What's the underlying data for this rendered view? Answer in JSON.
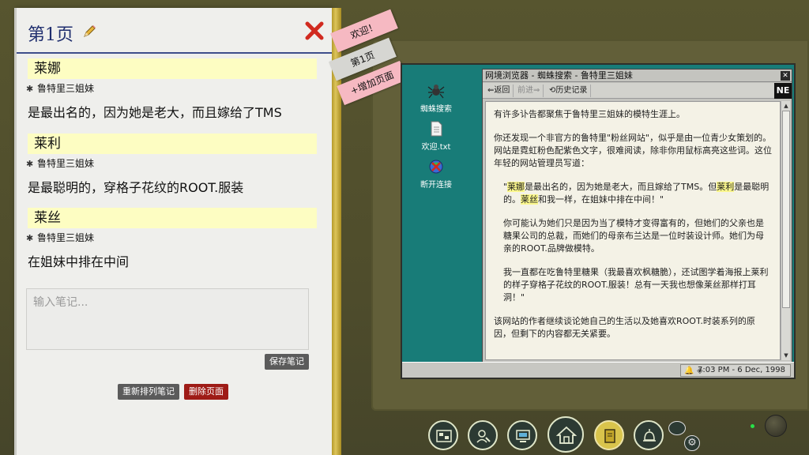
{
  "notebook": {
    "page_title": "第1页",
    "entries": [
      {
        "name": "莱娜",
        "tag": "鲁特里三姐妹",
        "note": "是最出名的，因为她是老大，而且嫁给了TMS"
      },
      {
        "name": "莱利",
        "tag": "鲁特里三姐妹",
        "note": "是最聪明的，穿格子花纹的ROOT.服装"
      },
      {
        "name": "莱丝",
        "tag": "鲁特里三姐妹",
        "note": "在姐妹中排在中间"
      }
    ],
    "note_placeholder": "输入笔记...",
    "save_label": "保存笔记",
    "reorder_label": "重新排列笔记",
    "delete_label": "删除页面"
  },
  "tabs": {
    "welcome": "欢迎！",
    "page1": "第1页",
    "add": "+增加页面"
  },
  "desktop": {
    "icons": [
      {
        "label": "蜘蛛搜索",
        "icon": "spider-icon"
      },
      {
        "label": "欢迎.txt",
        "icon": "text-file-icon"
      },
      {
        "label": "断开连接",
        "icon": "disconnect-icon"
      }
    ],
    "clock": "7:03 PM - 6 Dec, 1998"
  },
  "browser": {
    "title": "网境浏览器 - 蜘蛛搜索 - 鲁特里三姐妹",
    "back": "返回",
    "forward": "前进",
    "history": "历史记录",
    "logo": "NE",
    "p1": "有许多讣告都聚焦于鲁特里三姐妹的模特生涯上。",
    "p2": "你还发现一个非官方的鲁特里\"粉丝网站\"，似乎是由一位青少女策划的。网站是霓虹粉色配紫色文字，很难阅读，除非你用鼠标高亮这些词。这位年轻的网站管理员写道：",
    "q1_a": "\"",
    "q1_hl1": "莱娜",
    "q1_b": "是最出名的，因为她是老大，而且嫁给了TMS。但",
    "q1_hl2": "莱利",
    "q1_c": "是最聪明的。",
    "q1_hl3": "莱丝",
    "q1_d": "和我一样，在姐妹中排在中间！\"",
    "q2": "你可能认为她们只是因为当了模特才变得富有的，但她们的父亲也是糖果公司的总裁，而她们的母亲布兰达是一位时装设计师。她们为母亲的ROOT.品牌做模特。",
    "q3": "我一直都在吃鲁特里糖果（我最喜欢枫糖脆），还试图学着海报上莱利的样子穿格子花纹的ROOT.服装！总有一天我也想像莱丝那样打耳洞！\"",
    "p3": "该网站的作者继续谈论她自己的生活以及她喜欢ROOT.时装系列的原因，但剩下的内容都无关紧要。"
  },
  "colors": {
    "highlight": "#fbf78c",
    "name_bar": "#fdfdc2",
    "delete": "#9e1b16",
    "screen": "#187c78"
  }
}
